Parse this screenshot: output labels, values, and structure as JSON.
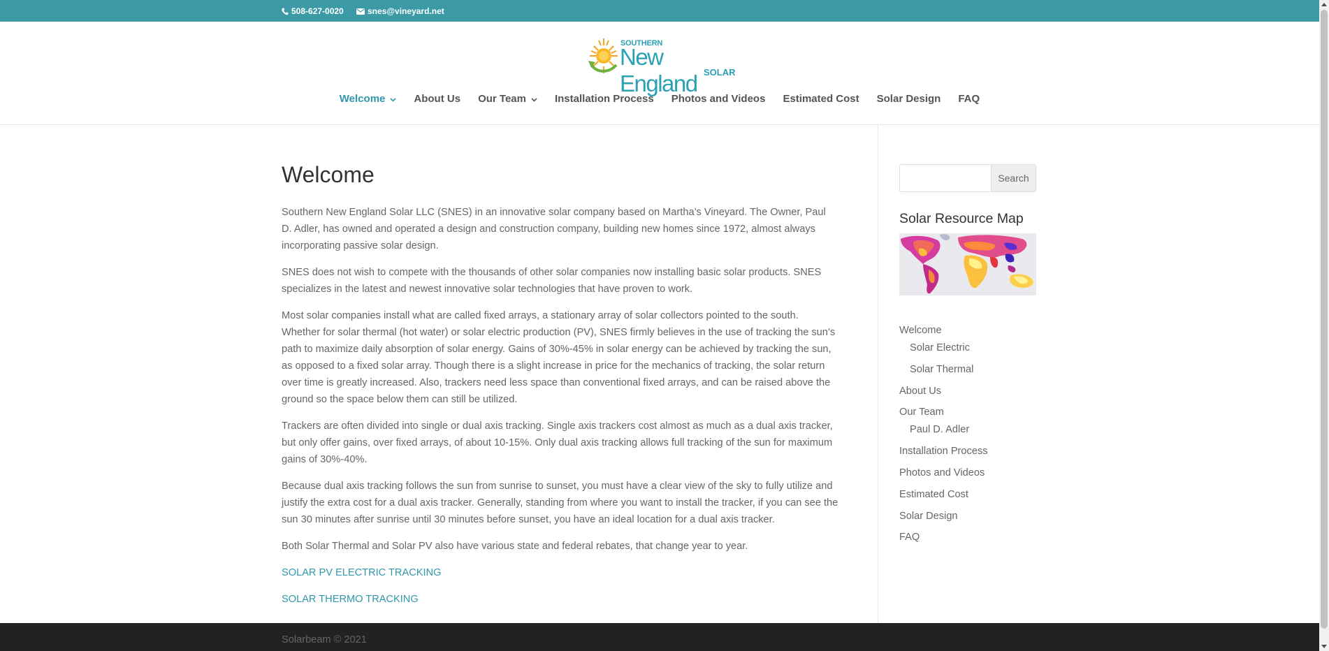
{
  "top_bar": {
    "phone": "508-627-0020",
    "email": "snes@vineyard.net",
    "background": "#3b9aa6"
  },
  "logo": {
    "line1": "SOUTHERN",
    "line2": "New England",
    "line3": "SOLAR"
  },
  "nav": [
    {
      "label": "Welcome",
      "active": true,
      "has_dropdown": true
    },
    {
      "label": "About Us",
      "active": false,
      "has_dropdown": false
    },
    {
      "label": "Our Team",
      "active": false,
      "has_dropdown": true
    },
    {
      "label": "Installation Process",
      "active": false,
      "has_dropdown": false
    },
    {
      "label": "Photos and Videos",
      "active": false,
      "has_dropdown": false
    },
    {
      "label": "Estimated Cost",
      "active": false,
      "has_dropdown": false
    },
    {
      "label": "Solar Design",
      "active": false,
      "has_dropdown": false
    },
    {
      "label": "FAQ",
      "active": false,
      "has_dropdown": false
    }
  ],
  "main": {
    "title": "Welcome",
    "paragraphs": [
      "Southern New England Solar LLC (SNES) in an innovative solar company based on Martha’s Vineyard. The Owner, Paul D. Adler, has owned and operated a design and construction company, building new homes since 1972, almost always incorporating passive solar design.",
      "SNES does not wish to compete with the thousands of other solar companies now installing basic solar products. SNES specializes in the latest and newest innovative solar technologies that have proven to work.",
      "Most solar companies install what are called fixed arrays, a stationary array of solar collectors pointed to the south. Whether for solar thermal (hot water) or solar electric production (PV), SNES firmly believes in the use of tracking the sun’s path to maximize daily absorption of solar energy. Gains of 30%-45% in solar energy can be achieved by tracking the sun, as opposed to a fixed solar array. Though there is a slight increase in price for the mechanics of tracking, the solar return over time is greatly increased. Also, trackers need less space than conventional fixed arrays, and can be raised above the ground so the space below them can still be utilized.",
      "Trackers are often divided into single or dual axis tracking. Single axis trackers cost almost as much as a dual axis tracker, but only offer gains, over fixed arrays, of about 10-15%. Only dual axis tracking allows full tracking of the sun for maximum gains of 30%-40%.",
      "Because dual axis tracking follows the sun from sunrise to sunset, you must have a clear view of the sky to fully utilize and justify the extra cost for a dual axis tracker. Generally, standing from where you want to install the tracker, if you can see the sun 30 minutes after sunrise until 30 minutes before sunset, you have an ideal location for a dual axis tracker.",
      "Both Solar Thermal and Solar PV also have various state and federal rebates, that change year to year."
    ],
    "links": [
      "SOLAR PV ELECTRIC TRACKING",
      "SOLAR THERMO TRACKING"
    ]
  },
  "sidebar": {
    "search": {
      "placeholder": "",
      "button_label": "Search"
    },
    "widget_title": "Solar Resource Map",
    "pages": [
      {
        "label": "Welcome",
        "sub": false
      },
      {
        "label": "Solar Electric",
        "sub": true
      },
      {
        "label": "Solar Thermal",
        "sub": true
      },
      {
        "label": "About Us",
        "sub": false
      },
      {
        "label": "Our Team",
        "sub": false
      },
      {
        "label": "Paul D. Adler",
        "sub": true
      },
      {
        "label": "Installation Process",
        "sub": false
      },
      {
        "label": "Photos and Videos",
        "sub": false
      },
      {
        "label": "Estimated Cost",
        "sub": false
      },
      {
        "label": "Solar Design",
        "sub": false
      },
      {
        "label": "FAQ",
        "sub": false
      }
    ]
  },
  "footer": {
    "credit": "Solarbeam © 2021"
  },
  "colors": {
    "accent": "#2f98aa",
    "footer_bg": "#222222"
  }
}
